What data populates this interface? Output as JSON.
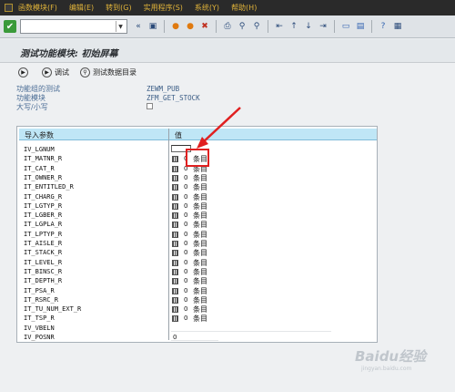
{
  "menu": {
    "items": [
      "函数模块(F)",
      "编辑(E)",
      "转到(G)",
      "实用程序(S)",
      "系统(Y)",
      "帮助(H)"
    ]
  },
  "toolbar": {
    "command_field_value": ""
  },
  "title": "测试功能模块: 初始屏幕",
  "app_toolbar": {
    "run_label": "调试",
    "testdata_label": "测试数据目录"
  },
  "info": {
    "group_label": "功能组的测试",
    "group_value": "ZEWM_PUB",
    "module_label": "功能模块",
    "module_value": "ZFM_GET_STOCK",
    "case_label": "大写/小写"
  },
  "table": {
    "header_param": "导入参数",
    "header_value": "值",
    "entries_unit": "条目",
    "rows": [
      {
        "name": "IV_LGNUM",
        "type": "field",
        "value": ""
      },
      {
        "name": "IT_MATNR_R",
        "type": "table",
        "count": "0"
      },
      {
        "name": "IT_CAT_R",
        "type": "table",
        "count": "0"
      },
      {
        "name": "IT_OWNER_R",
        "type": "table",
        "count": "0"
      },
      {
        "name": "IT_ENTITLED_R",
        "type": "table",
        "count": "0"
      },
      {
        "name": "IT_CHARG_R",
        "type": "table",
        "count": "0"
      },
      {
        "name": "IT_LGTYP_R",
        "type": "table",
        "count": "0"
      },
      {
        "name": "IT_LGBER_R",
        "type": "table",
        "count": "0"
      },
      {
        "name": "IT_LGPLA_R",
        "type": "table",
        "count": "0"
      },
      {
        "name": "IT_LPTYP_R",
        "type": "table",
        "count": "0"
      },
      {
        "name": "IT_AISLE_R",
        "type": "table",
        "count": "0"
      },
      {
        "name": "IT_STACK_R",
        "type": "table",
        "count": "0"
      },
      {
        "name": "IT_LEVEL_R",
        "type": "table",
        "count": "0"
      },
      {
        "name": "IT_BINSC_R",
        "type": "table",
        "count": "0"
      },
      {
        "name": "IT_DEPTH_R",
        "type": "table",
        "count": "0"
      },
      {
        "name": "IT_PSA_R",
        "type": "table",
        "count": "0"
      },
      {
        "name": "IT_RSRC_R",
        "type": "table",
        "count": "0"
      },
      {
        "name": "IT_TU_NUM_EXT_R",
        "type": "table",
        "count": "0"
      },
      {
        "name": "IT_TSP_R",
        "type": "table",
        "count": "0"
      },
      {
        "name": "IV_VBELN",
        "type": "field",
        "value": ""
      },
      {
        "name": "IV_POSNR",
        "type": "field",
        "value": "0"
      }
    ]
  },
  "watermark": {
    "brand": "Baidu经验",
    "url": "jingyan.baidu.com"
  },
  "colors": {
    "menubar_bg": "#2a2a2a",
    "menu_text": "#e0b33a",
    "header_bg": "#bfe6f6",
    "highlight": "#e02020"
  }
}
